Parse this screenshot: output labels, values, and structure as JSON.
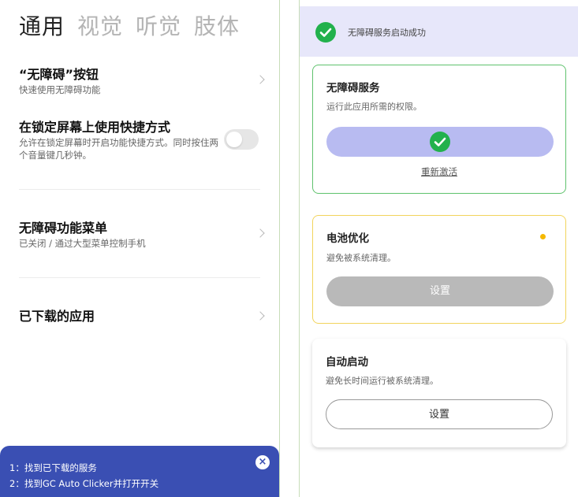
{
  "left": {
    "tabs": [
      {
        "label": "通用"
      },
      {
        "label": "视觉"
      },
      {
        "label": "听觉"
      },
      {
        "label": "肢体"
      }
    ],
    "items": [
      {
        "title": "“无障碍”按钮",
        "subtitle": "快速使用无障碍功能"
      },
      {
        "title": "在锁定屏幕上使用快捷方式",
        "subtitle": "允许在锁定屏幕时开启功能快捷方式。同时按住两个音量键几秒钟。"
      },
      {
        "title": "无障碍功能菜单",
        "subtitle": "已关闭 / 通过大型菜单控制手机"
      },
      {
        "title": "已下载的应用",
        "subtitle": ""
      }
    ],
    "tip": {
      "line1": "1：找到已下载的服务",
      "line2": "2：找到GC Auto Clicker并打开开关"
    }
  },
  "right": {
    "banner": {
      "message": "无障碍服务启动成功"
    },
    "cards": [
      {
        "title": "无障碍服务",
        "subtitle": "运行此应用所需的权限。",
        "link": "重新激活"
      },
      {
        "title": "电池优化",
        "subtitle": "避免被系统清理。",
        "button": "设置"
      },
      {
        "title": "自动启动",
        "subtitle": "避免长时间运行被系统清理。",
        "button": "设置"
      }
    ]
  },
  "colors": {
    "accent_blue": "#3a4fb3",
    "success_green": "#22b14c",
    "warning_yellow": "#f5b800"
  }
}
